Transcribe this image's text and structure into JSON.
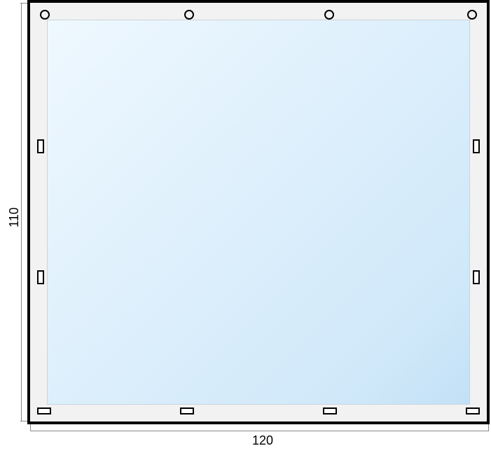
{
  "diagram": {
    "width_label": "120",
    "height_label": "110",
    "markers": {
      "top_rings": 4,
      "side_slots_per_side": 2,
      "bottom_slots": 4
    }
  }
}
